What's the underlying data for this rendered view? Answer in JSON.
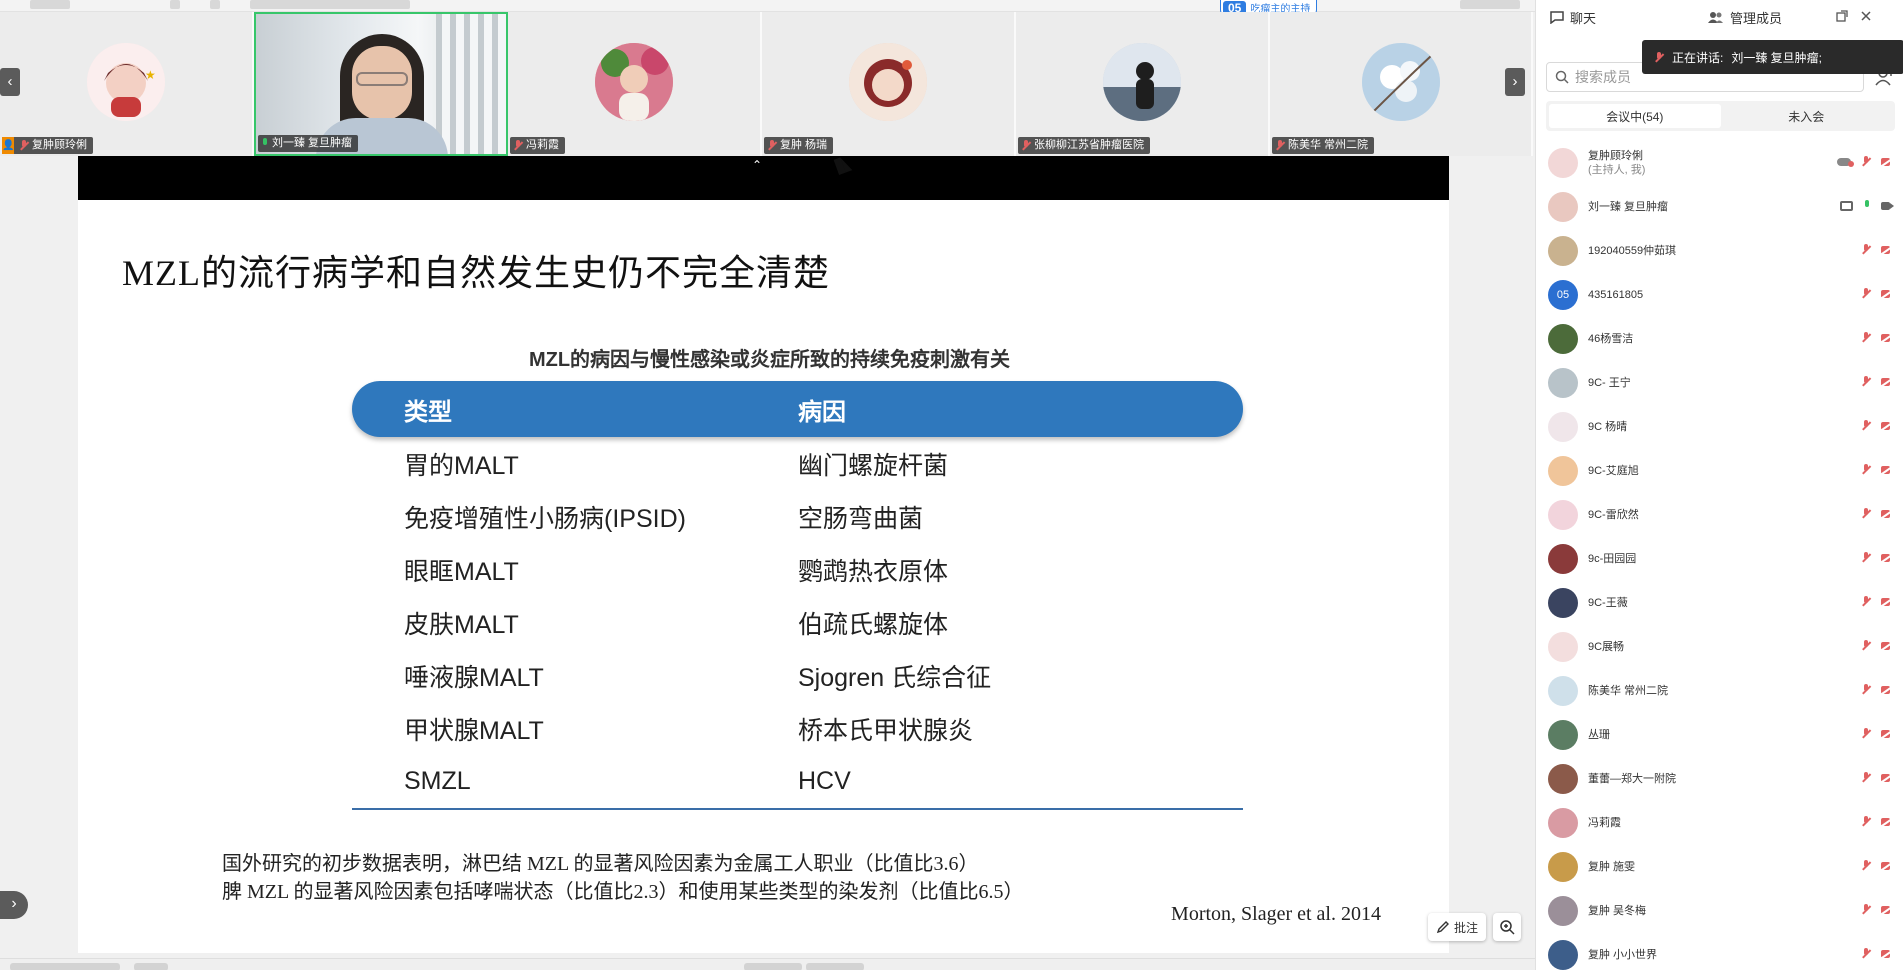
{
  "meeting_badge": {
    "number": "05",
    "label": "吃瘤主的主持"
  },
  "participants_strip": [
    {
      "name": "复肿顾玲俐",
      "host": true,
      "avatar_color": "#f3d6d6"
    },
    {
      "name": "刘一臻 复旦肿瘤",
      "host": false,
      "active": true
    },
    {
      "name": "冯莉霞",
      "host": false,
      "avatar_color": "#e8b7a4"
    },
    {
      "name": "复肿 杨瑞",
      "host": false,
      "avatar_color": "#ead1c4"
    },
    {
      "name": "张柳柳江苏省肿瘤医院",
      "host": false,
      "avatar_color": "#c6cfd8"
    },
    {
      "name": "陈美华 常州二院",
      "host": false,
      "avatar_color": "#d6e4ee"
    }
  ],
  "nav": {
    "prev": "‹",
    "next": "›",
    "collapse": "⌃",
    "side_toggle": "›"
  },
  "slide": {
    "title": "MZL的流行病学和自然发生史仍不完全清楚",
    "table_caption": "MZL的病因与慢性感染或炎症所致的持续免疫刺激有关",
    "table_headers": [
      "类型",
      "病因"
    ],
    "table_rows": [
      [
        "胃的MALT",
        "幽门螺旋杆菌"
      ],
      [
        "免疫增殖性小肠病(IPSID)",
        "空肠弯曲菌"
      ],
      [
        "眼眶MALT",
        "鹦鹉热衣原体"
      ],
      [
        "皮肤MALT",
        "伯疏氏螺旋体"
      ],
      [
        "唾液腺MALT",
        "Sjogren 氏综合征"
      ],
      [
        "甲状腺MALT",
        "桥本氏甲状腺炎"
      ],
      [
        "SMZL",
        "HCV"
      ]
    ],
    "note_line1": "国外研究的初步数据表明，淋巴结 MZL 的显著风险因素为金属工人职业（比值比3.6）",
    "note_line2": "脾 MZL 的显著风险因素包括哮喘状态（比值比2.3）和使用某些类型的染发剂（比值比6.5）",
    "citation": "Morton, Slager et al. 2014"
  },
  "slide_tools": {
    "annotate_label": "批注",
    "annotate_icon": "pen-icon",
    "zoom_icon": "zoom-in-icon"
  },
  "panel": {
    "chat_tab": "聊天",
    "manage_tab": "管理成员",
    "speaking_prefix": "正在讲话:",
    "speaking_name": "刘一臻 复旦肿瘤;",
    "search_placeholder": "搜索成员",
    "seg_in_meeting": "会议中(54)",
    "seg_not_joined": "未入会"
  },
  "member_list": [
    {
      "name": "复肿顾玲俐",
      "sub": "(主持人, 我)",
      "color": "#f2d7d7",
      "mic": "off",
      "cam": "off",
      "extra": "cloud"
    },
    {
      "name": "刘一臻 复旦肿瘤",
      "sub": "",
      "color": "#e9c8c0",
      "mic": "on",
      "cam": "on",
      "extra": "screen"
    },
    {
      "name": "192040559仲茹琪",
      "sub": "",
      "color": "#c9b28f",
      "mic": "off",
      "cam": "off"
    },
    {
      "name": "435161805",
      "sub": "",
      "color": "#2b6fd1",
      "initials": "05",
      "mic": "off",
      "cam": "off"
    },
    {
      "name": "46杨雪洁",
      "sub": "",
      "color": "#4c6b3a",
      "mic": "off",
      "cam": "off"
    },
    {
      "name": "9C- 王宁",
      "sub": "",
      "color": "#b8c3c9",
      "mic": "off",
      "cam": "off"
    },
    {
      "name": "9C 杨晴",
      "sub": "",
      "color": "#f0e6ea",
      "mic": "off",
      "cam": "off"
    },
    {
      "name": "9C-艾庭旭",
      "sub": "",
      "color": "#f0c59a",
      "mic": "off",
      "cam": "off"
    },
    {
      "name": "9C-雷欣然",
      "sub": "",
      "color": "#f2d4dc",
      "mic": "off",
      "cam": "off"
    },
    {
      "name": "9c-田园园",
      "sub": "",
      "color": "#8a3a3a",
      "mic": "off",
      "cam": "off"
    },
    {
      "name": "9C-王薇",
      "sub": "",
      "color": "#3a4460",
      "mic": "off",
      "cam": "off"
    },
    {
      "name": "9C展畅",
      "sub": "",
      "color": "#f3dede",
      "mic": "off",
      "cam": "off"
    },
    {
      "name": "陈美华 常州二院",
      "sub": "",
      "color": "#cfe0ea",
      "mic": "off",
      "cam": "off"
    },
    {
      "name": "丛珊",
      "sub": "",
      "color": "#5b7d63",
      "mic": "off",
      "cam": "off"
    },
    {
      "name": "董蕾—郑大一附院",
      "sub": "",
      "color": "#8b5a4a",
      "mic": "off",
      "cam": "off"
    },
    {
      "name": "冯莉霞",
      "sub": "",
      "color": "#d99ba3",
      "mic": "off",
      "cam": "off"
    },
    {
      "name": "复肿 施雯",
      "sub": "",
      "color": "#c89b4a",
      "mic": "off",
      "cam": "off"
    },
    {
      "name": "复肿 吴冬梅",
      "sub": "",
      "color": "#9b8f99",
      "mic": "off",
      "cam": "off"
    },
    {
      "name": "复肿 小小世界",
      "sub": "",
      "color": "#3d5e8a",
      "mic": "off",
      "cam": "off"
    }
  ]
}
